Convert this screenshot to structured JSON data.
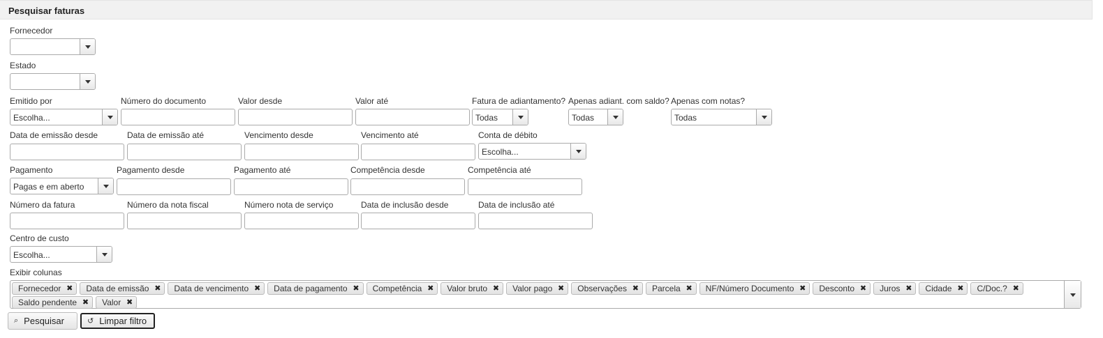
{
  "panel": {
    "title": "Pesquisar faturas"
  },
  "fields": {
    "fornecedor": {
      "label": "Fornecedor",
      "value": ""
    },
    "estado": {
      "label": "Estado",
      "value": ""
    },
    "emitido_por": {
      "label": "Emitido por",
      "value": "Escolha..."
    },
    "numero_documento": {
      "label": "Número do documento",
      "value": ""
    },
    "valor_desde": {
      "label": "Valor desde",
      "value": ""
    },
    "valor_ate": {
      "label": "Valor até",
      "value": ""
    },
    "fatura_adiantamento": {
      "label": "Fatura de adiantamento?",
      "value": "Todas"
    },
    "apenas_adiant_saldo": {
      "label": "Apenas adiant. com saldo?",
      "value": "Todas"
    },
    "apenas_com_notas": {
      "label": "Apenas com notas?",
      "value": "Todas"
    },
    "data_emissao_desde": {
      "label": "Data de emissão desde",
      "value": ""
    },
    "data_emissao_ate": {
      "label": "Data de emissão até",
      "value": ""
    },
    "vencimento_desde": {
      "label": "Vencimento desde",
      "value": ""
    },
    "vencimento_ate": {
      "label": "Vencimento até",
      "value": ""
    },
    "conta_debito": {
      "label": "Conta de débito",
      "value": "Escolha..."
    },
    "pagamento": {
      "label": "Pagamento",
      "value": "Pagas e em aberto"
    },
    "pagamento_desde": {
      "label": "Pagamento desde",
      "value": ""
    },
    "pagamento_ate": {
      "label": "Pagamento até",
      "value": ""
    },
    "competencia_desde": {
      "label": "Competência desde",
      "value": ""
    },
    "competencia_ate": {
      "label": "Competência até",
      "value": ""
    },
    "numero_fatura": {
      "label": "Número da fatura",
      "value": ""
    },
    "numero_nota_fiscal": {
      "label": "Número da nota fiscal",
      "value": ""
    },
    "numero_nota_servico": {
      "label": "Número nota de serviço",
      "value": ""
    },
    "data_inclusao_desde": {
      "label": "Data de inclusão desde",
      "value": ""
    },
    "data_inclusao_ate": {
      "label": "Data de inclusão até",
      "value": ""
    },
    "centro_custo": {
      "label": "Centro de custo",
      "value": "Escolha..."
    }
  },
  "columns": {
    "label": "Exibir colunas",
    "remove_glyph": "✖",
    "selected": [
      "Fornecedor",
      "Data de emissão",
      "Data de vencimento",
      "Data de pagamento",
      "Competência",
      "Valor bruto",
      "Valor pago",
      "Observações",
      "Parcela",
      "NF/Número Documento",
      "Desconto",
      "Juros",
      "Cidade",
      "C/Doc.?",
      "Saldo pendente",
      "Valor"
    ]
  },
  "buttons": {
    "search": {
      "label": "Pesquisar",
      "icon": "search-icon"
    },
    "clear": {
      "label": "Limpar filtro",
      "icon": "reset-icon"
    }
  }
}
